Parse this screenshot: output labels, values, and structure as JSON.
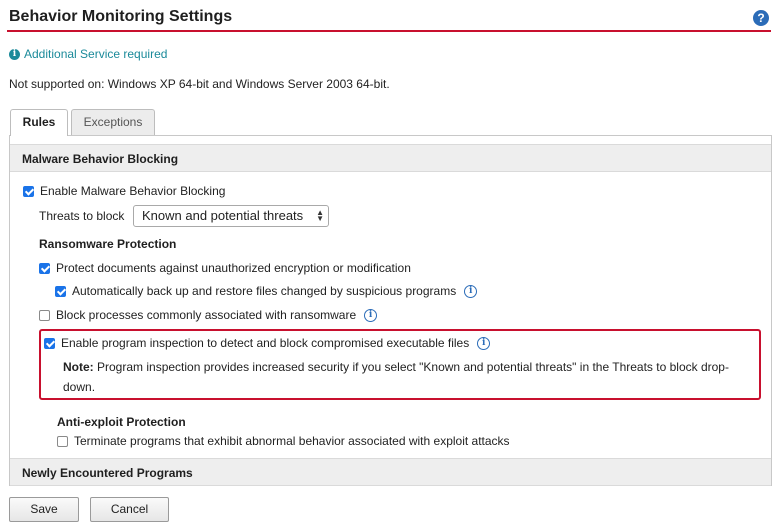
{
  "header": {
    "title": "Behavior Monitoring Settings",
    "help_glyph": "?"
  },
  "service_notice": {
    "icon_glyph": "i",
    "text": "Additional Service required"
  },
  "not_supported": "Not supported on: Windows XP 64-bit and Windows Server 2003 64-bit.",
  "tabs": [
    {
      "label": "Rules",
      "active": true
    },
    {
      "label": "Exceptions",
      "active": false
    }
  ],
  "malware": {
    "section_title": "Malware Behavior Blocking",
    "enable_label": "Enable Malware Behavior Blocking",
    "enable_checked": true,
    "threats_label": "Threats to block",
    "threats_value": "Known and potential threats",
    "ransomware_heading": "Ransomware Protection",
    "protect_docs_label": "Protect documents against unauthorized encryption or modification",
    "protect_docs_checked": true,
    "auto_backup_label": "Automatically back up and restore files changed by suspicious programs",
    "auto_backup_checked": true,
    "block_processes_label": "Block processes commonly associated with ransomware",
    "block_processes_checked": false,
    "program_inspection_label": "Enable program inspection to detect and block compromised executable files",
    "program_inspection_checked": true,
    "note_prefix": "Note:",
    "note_text": " Program inspection provides increased security if you select \"Known and potential threats\" in the Threats to block drop-down.",
    "anti_exploit_heading": "Anti-exploit Protection",
    "terminate_label": "Terminate programs that exhibit abnormal behavior associated with exploit attacks",
    "terminate_checked": false,
    "tooltip_glyph": "i"
  },
  "new_programs": {
    "section_title": "Newly Encountered Programs"
  },
  "buttons": {
    "save": "Save",
    "cancel": "Cancel"
  },
  "colors": {
    "accent_red": "#c8102e",
    "link_teal": "#1b8a9a",
    "checkbox_blue": "#1a73e8"
  }
}
